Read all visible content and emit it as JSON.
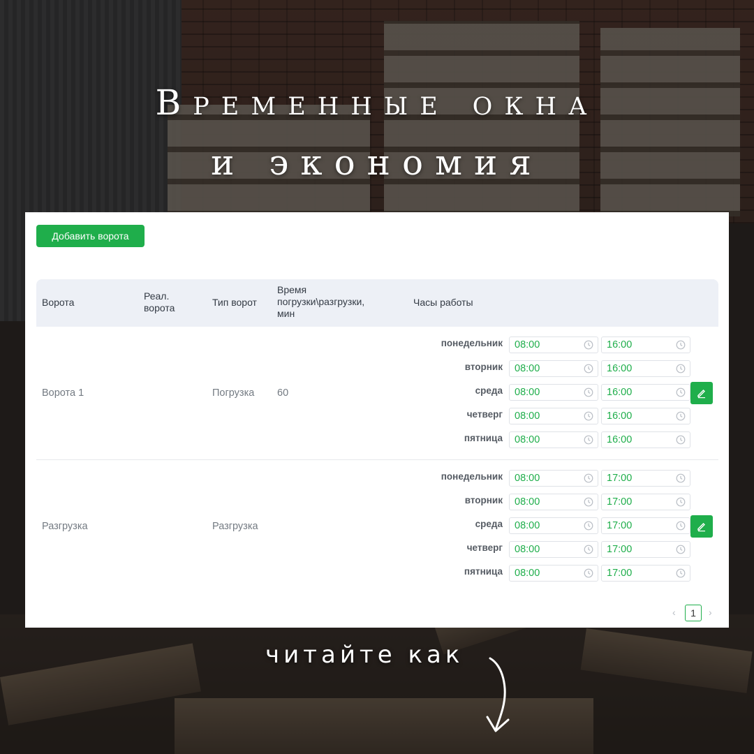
{
  "headline": {
    "line1": "Временные окна",
    "line2": "и экономия"
  },
  "toolbar": {
    "add_gate_label": "Добавить ворота"
  },
  "table": {
    "headers": {
      "gate": "Ворота",
      "real_gate_1": "Реал.",
      "real_gate_2": "ворота",
      "gate_type": "Тип ворот",
      "time_1": "Время",
      "time_2": "погрузки\\разгрузки,",
      "time_3": "мин",
      "hours": "Часы работы"
    },
    "rows": [
      {
        "gate": "Ворота 1",
        "real_gate": "",
        "type": "Погрузка",
        "duration": "60",
        "schedule": [
          {
            "day": "понедельник",
            "from": "08:00",
            "to": "16:00"
          },
          {
            "day": "вторник",
            "from": "08:00",
            "to": "16:00"
          },
          {
            "day": "среда",
            "from": "08:00",
            "to": "16:00"
          },
          {
            "day": "четверг",
            "from": "08:00",
            "to": "16:00"
          },
          {
            "day": "пятница",
            "from": "08:00",
            "to": "16:00"
          }
        ]
      },
      {
        "gate": "Разгрузка",
        "real_gate": "",
        "type": "Разгрузка",
        "duration": "",
        "schedule": [
          {
            "day": "понедельник",
            "from": "08:00",
            "to": "17:00"
          },
          {
            "day": "вторник",
            "from": "08:00",
            "to": "17:00"
          },
          {
            "day": "среда",
            "from": "08:00",
            "to": "17:00"
          },
          {
            "day": "четверг",
            "from": "08:00",
            "to": "17:00"
          },
          {
            "day": "пятница",
            "from": "08:00",
            "to": "17:00"
          }
        ]
      }
    ]
  },
  "pagination": {
    "current_page": "1",
    "prev_icon": "chevron-left-icon",
    "next_icon": "chevron-right-icon"
  },
  "footer": {
    "caption": "читайте как"
  },
  "colors": {
    "accent": "#1fae4b",
    "header_bg": "#edf0f6"
  }
}
